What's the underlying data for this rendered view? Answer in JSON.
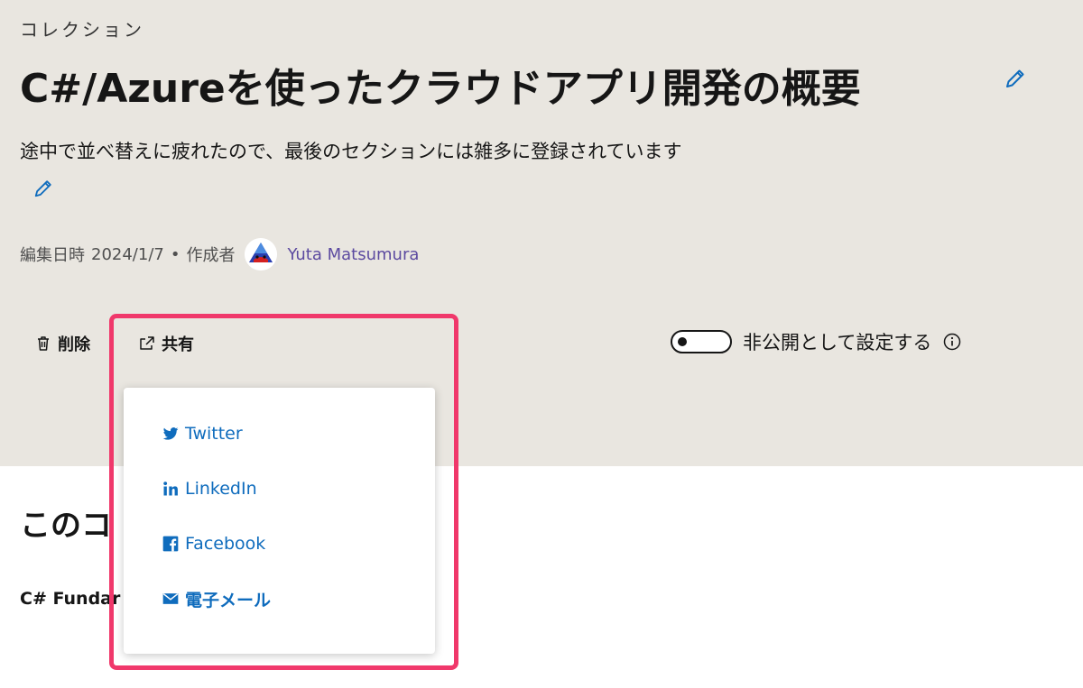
{
  "header": {
    "eyebrow": "コレクション",
    "title": "C#/Azureを使ったクラウドアプリ開発の概要",
    "description": "途中で並べ替えに疲れたので、最後のセクションには雑多に登録されています"
  },
  "meta": {
    "edited_label": "編集日時",
    "edited_date": "2024/1/7",
    "separator": "•",
    "author_label": "作成者",
    "author_name": "Yuta Matsumura"
  },
  "actions": {
    "delete_label": "削除",
    "share_label": "共有"
  },
  "privacy": {
    "label": "非公開として設定する",
    "enabled": false
  },
  "share_menu": {
    "items": [
      {
        "label": "Twitter",
        "icon": "twitter-icon"
      },
      {
        "label": "LinkedIn",
        "icon": "linkedin-icon"
      },
      {
        "label": "Facebook",
        "icon": "facebook-icon"
      },
      {
        "label": "電子メール",
        "icon": "mail-icon"
      }
    ]
  },
  "content": {
    "section_heading": "このコ",
    "first_item": "C# Fundar"
  },
  "colors": {
    "hero_background": "#e9e6e0",
    "link": "#0f6cbd",
    "author": "#5c4aa0",
    "highlight": "#f0386b"
  }
}
